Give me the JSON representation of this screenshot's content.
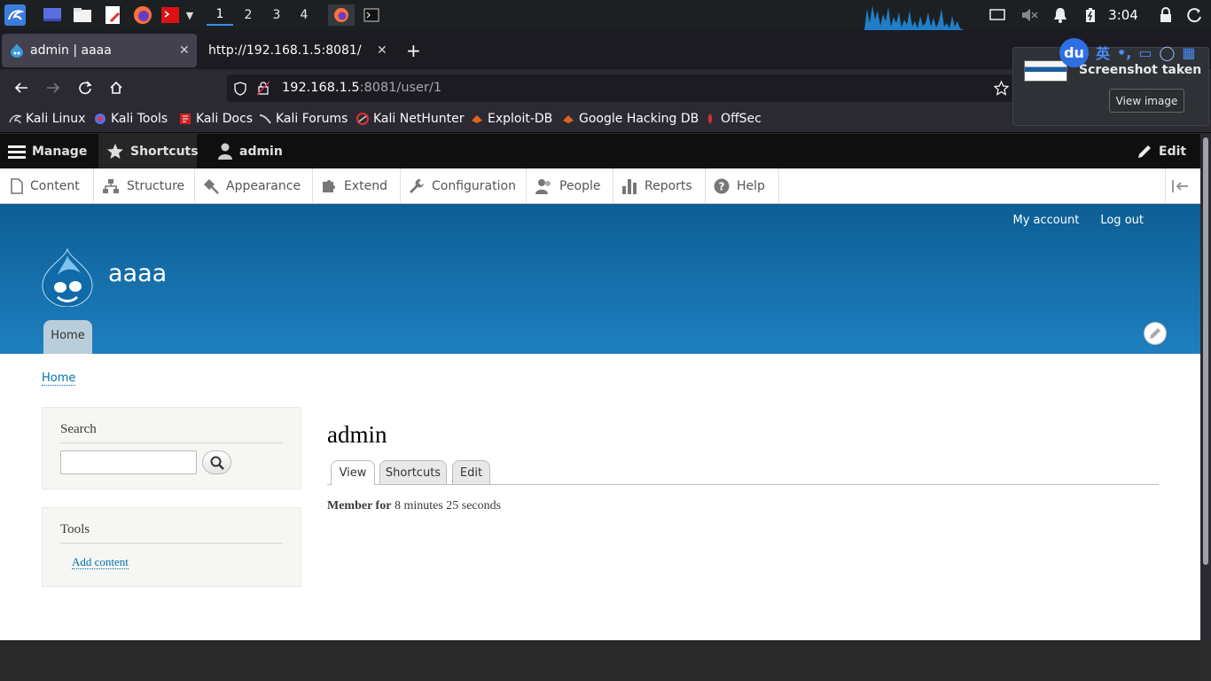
{
  "taskbar": {
    "workspaces": [
      "1",
      "2",
      "3",
      "4"
    ],
    "clock": "3:04"
  },
  "browser": {
    "tabs": [
      {
        "title": "admin | aaaa",
        "active": true
      },
      {
        "title": "http://192.168.1.5:8081/",
        "active": false
      }
    ],
    "url_host": "192.168.1.5",
    "url_rest": ":8081/user/1",
    "bookmarks": [
      "Kali Linux",
      "Kali Tools",
      "Kali Docs",
      "Kali Forums",
      "Kali NetHunter",
      "Exploit-DB",
      "Google Hacking DB",
      "OffSec"
    ]
  },
  "notification": {
    "title": "Screenshot taken",
    "button": "View image"
  },
  "ime": {
    "logo": "du",
    "lang": "英"
  },
  "admin_toolbar": {
    "manage": "Manage",
    "shortcuts": "Shortcuts",
    "user": "admin",
    "edit": "Edit",
    "menu": [
      "Content",
      "Structure",
      "Appearance",
      "Extend",
      "Configuration",
      "People",
      "Reports",
      "Help"
    ]
  },
  "header": {
    "secondary_menu": [
      "My account",
      "Log out"
    ],
    "site_name": "aaaa",
    "main_menu": [
      "Home"
    ]
  },
  "content": {
    "breadcrumb": "Home",
    "search_block_title": "Search",
    "tools_block_title": "Tools",
    "tools_link": "Add content",
    "page_title": "admin",
    "local_tasks": [
      "View",
      "Shortcuts",
      "Edit"
    ],
    "member_label": "Member for",
    "member_value": "8 minutes 25 seconds"
  },
  "colors": {
    "header_blue": "#1e7fc0",
    "link_blue": "#0071b3",
    "admin_bar": "#0f0f0f"
  }
}
